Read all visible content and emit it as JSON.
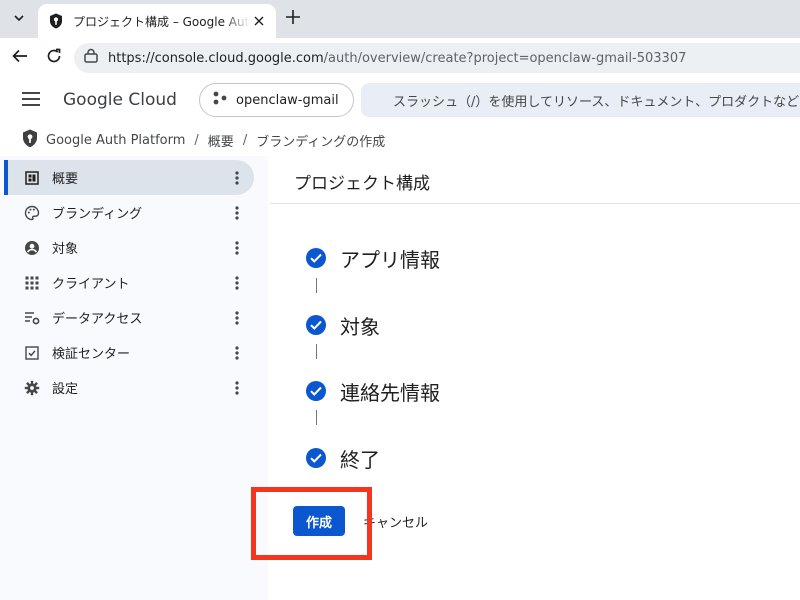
{
  "browser": {
    "tab_title": "プロジェクト構成 – Google Auth Platform",
    "url_host": "https://console.cloud.google.com",
    "url_path": "/auth/overview/create?project=openclaw-gmail-503307"
  },
  "header": {
    "logo_text": "Google Cloud",
    "project_name": "openclaw-gmail",
    "search_placeholder": "スラッシュ（/）を使用してリソース、ドキュメント、プロダクトなど"
  },
  "breadcrumb": {
    "root": "Google Auth Platform",
    "parent": "概要",
    "current": "ブランディングの作成",
    "separator": "/"
  },
  "sidebar": {
    "items": [
      {
        "label": "概要",
        "icon": "dashboard-icon"
      },
      {
        "label": "ブランディング",
        "icon": "palette-icon"
      },
      {
        "label": "対象",
        "icon": "account-circle-icon"
      },
      {
        "label": "クライアント",
        "icon": "apps-grid-icon"
      },
      {
        "label": "データアクセス",
        "icon": "data-settings-icon"
      },
      {
        "label": "検証センター",
        "icon": "checkbox-icon"
      },
      {
        "label": "設定",
        "icon": "gear-icon"
      }
    ]
  },
  "main": {
    "title": "プロジェクト構成",
    "steps": [
      {
        "label": "アプリ情報"
      },
      {
        "label": "対象"
      },
      {
        "label": "連絡先情報"
      },
      {
        "label": "終了"
      }
    ],
    "create_label": "作成",
    "cancel_label": "キャンセル"
  },
  "colors": {
    "accent": "#0b57d0",
    "highlight": "#f4361f",
    "sidebar_bg": "#f8fafd"
  }
}
